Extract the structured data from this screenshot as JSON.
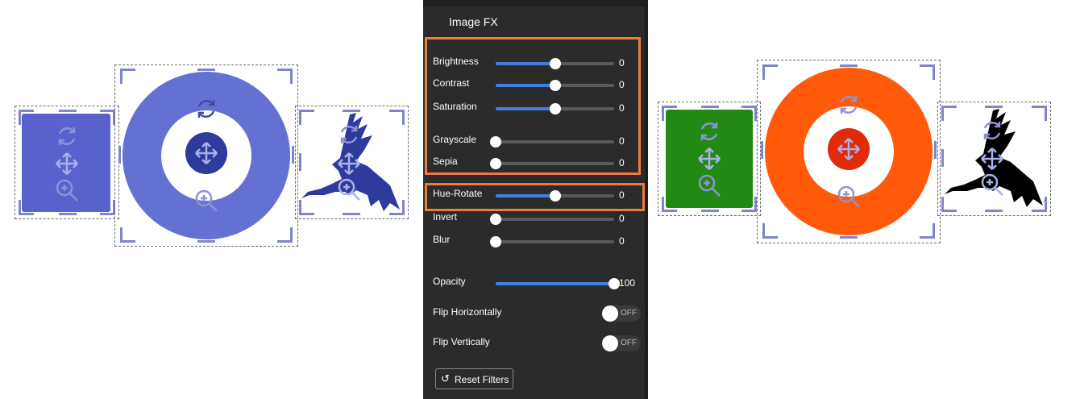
{
  "panel": {
    "title": "Image FX",
    "sliders": [
      {
        "key": "brightness",
        "label": "Brightness",
        "value": "0",
        "level": 0.5
      },
      {
        "key": "contrast",
        "label": "Contrast",
        "value": "0",
        "level": 0.5
      },
      {
        "key": "saturation",
        "label": "Saturation",
        "value": "0",
        "level": 0.5
      },
      {
        "key": "grayscale",
        "label": "Grayscale",
        "value": "0",
        "level": 0
      },
      {
        "key": "sepia",
        "label": "Sepia",
        "value": "0",
        "level": 0
      },
      {
        "key": "hue-rotate",
        "label": "Hue-Rotate",
        "value": "0",
        "level": 0.5
      },
      {
        "key": "invert",
        "label": "Invert",
        "value": "0",
        "level": 0
      },
      {
        "key": "blur",
        "label": "Blur",
        "value": "0",
        "level": 0
      },
      {
        "key": "opacity",
        "label": "Opacity",
        "value": "100",
        "level": 1
      }
    ],
    "toggles": [
      {
        "key": "flip-horizontally",
        "label": "Flip Horizontally",
        "state": "OFF"
      },
      {
        "key": "flip-vertically",
        "label": "Flip Vertically",
        "state": "OFF"
      }
    ],
    "reset_label": "Reset Filters",
    "reset_icon": "reset-icon"
  },
  "colors": {
    "before_fill": "#6470d2",
    "before_dark": "#2e3a9c",
    "after_square": "#228a14",
    "after_ring": "#ff5a0a",
    "after_center": "#e02a0a",
    "after_dragon": "#000000",
    "highlight": "#ee7b3e",
    "slider_accent": "#3f7fe0"
  },
  "canvas_icons": [
    "rotate-icon",
    "move-icon",
    "zoom-icon"
  ]
}
